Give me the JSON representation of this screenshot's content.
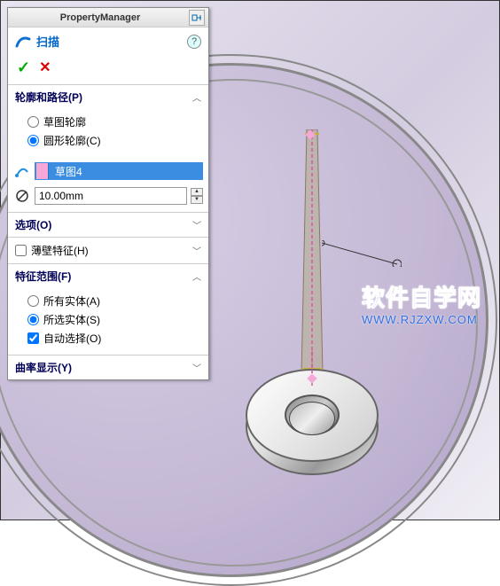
{
  "panel": {
    "title": "PropertyManager",
    "feature_name": "扫描",
    "sections": {
      "profile_path": {
        "title": "轮廓和路径(P)",
        "radio_sketch": "草图轮廓",
        "radio_circle": "圆形轮廓(C)",
        "path_value": "草图4",
        "diameter_value": "10.00mm"
      },
      "options": {
        "title": "选项(O)"
      },
      "thin": {
        "label": "薄壁特征(H)"
      },
      "scope": {
        "title": "特征范围(F)",
        "radio_all": "所有实体(A)",
        "radio_selected": "所选实体(S)",
        "check_auto": "自动选择(O)"
      },
      "curvature": {
        "title": "曲率显示(Y)"
      }
    }
  },
  "watermark": {
    "main": "软件自学网",
    "sub": "WWW.RJZXW.COM"
  }
}
